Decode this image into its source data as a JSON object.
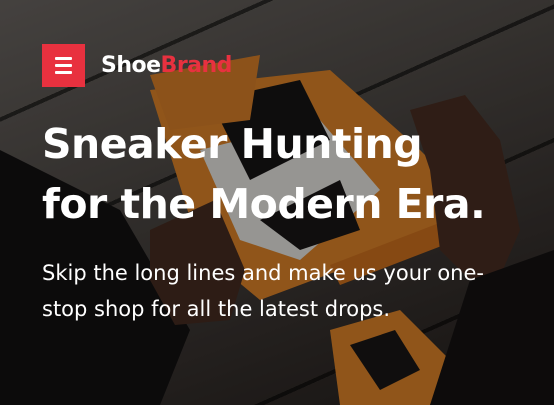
{
  "header": {
    "menu_icon": "hamburger-menu-icon",
    "brand_part1": "Shoe",
    "brand_part2": "Brand",
    "accent_color": "#e8313f"
  },
  "hero": {
    "title_line1": "Sneaker Hunting",
    "title_line2": "for the Modern Era.",
    "subtitle": "Skip the long lines and make us your one-stop shop for all the latest drops.",
    "background_image": "hands-holding-orange-white-sneaker"
  }
}
